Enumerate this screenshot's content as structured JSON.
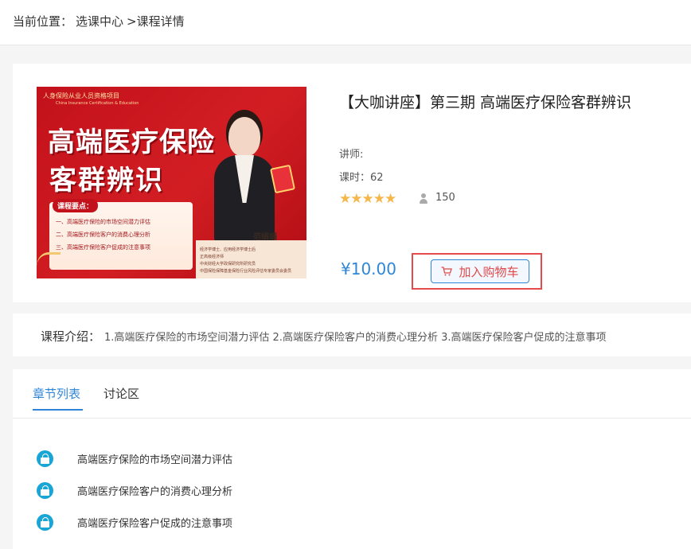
{
  "breadcrumb": {
    "prefix": "当前位置：",
    "items": [
      "选课中心",
      ">课程详情"
    ]
  },
  "course": {
    "cover": {
      "brand": "人身保险从业人员资格项目",
      "brand_en": "China Insurance Certification & Education",
      "headline_line1": "高端医疗保险",
      "headline_line2": "客群辨识",
      "keypoints_title": "课程要点：",
      "keypoints": [
        "一、高端医疗保险的市场空间潜力评估",
        "二、高端医疗保险客户的消费心理分析",
        "三、高端医疗保险客户促成的注意事项"
      ],
      "speaker_name": "范娟娟",
      "credentials": [
        "经济学博士、应用经济学博士后",
        "正高级经济师",
        "中央财经大学政保研究所研究员",
        "中国保险保障基金保险行业风险评估专家委员会委员"
      ]
    },
    "title": "【大咖讲座】第三期 高端医疗保险客群辨识",
    "lecturer_label": "讲师:",
    "lessons_label": "课时：62",
    "rating": 5,
    "stars": [
      "★",
      "★",
      "★",
      "★",
      "★"
    ],
    "students": "150",
    "price": "¥10.00",
    "cart_button": "加入购物车",
    "accent_color": "#2f86d8",
    "highlight_color": "#e54b4b"
  },
  "intro": {
    "label": "课程介绍：",
    "text": "1.高端医疗保险的市场空间潜力评估 2.高端医疗保险客户的消费心理分析 3.高端医疗保险客户促成的注意事项"
  },
  "tabs": [
    {
      "label": "章节列表",
      "active": true
    },
    {
      "label": "讨论区",
      "active": false
    }
  ],
  "chapters": [
    {
      "label": "高端医疗保险的市场空间潜力评估",
      "icon": "lock-icon"
    },
    {
      "label": "高端医疗保险客户的消费心理分析",
      "icon": "lock-icon"
    },
    {
      "label": "高端医疗保险客户促成的注意事项",
      "icon": "lock-icon"
    }
  ]
}
